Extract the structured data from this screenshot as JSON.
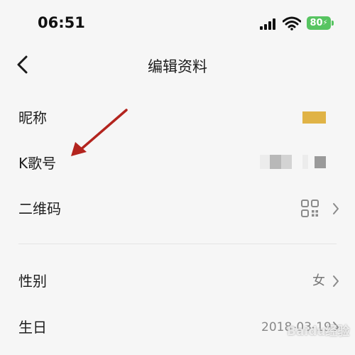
{
  "status_bar": {
    "time": "06:51",
    "battery": "80"
  },
  "nav": {
    "title": "编辑资料"
  },
  "rows": {
    "nickname": {
      "label": "昵称"
    },
    "kge_id": {
      "label": "K歌号"
    },
    "qr_code": {
      "label": "二维码"
    },
    "gender": {
      "label": "性别",
      "value": "女"
    },
    "birthday": {
      "label": "生日",
      "value": "2018-03-19"
    }
  },
  "watermark": "Baidu经验",
  "colors": {
    "background": "#f6f6f6",
    "arrow": "#b3241e",
    "battery": "#57c461",
    "nickname_swatch": "#e0b346"
  },
  "icons": [
    "back-chevron-icon",
    "signal-icon",
    "wifi-icon",
    "battery-icon",
    "qr-code-icon",
    "chevron-right-icon"
  ]
}
